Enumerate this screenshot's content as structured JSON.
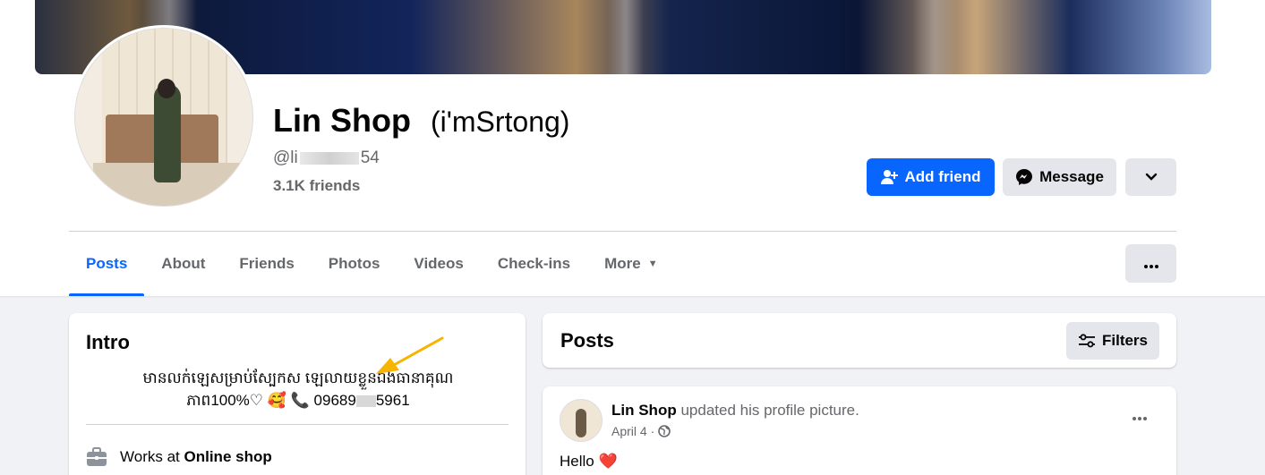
{
  "profile": {
    "name": "Lin Shop",
    "alternate_name": "(i'mSrtong)",
    "handle_start": "@li",
    "handle_end": "54",
    "friends_count": "3.1K friends"
  },
  "actions": {
    "add_friend": "Add friend",
    "message": "Message"
  },
  "tabs": [
    {
      "label": "Posts",
      "active": true
    },
    {
      "label": "About"
    },
    {
      "label": "Friends"
    },
    {
      "label": "Photos"
    },
    {
      "label": "Videos"
    },
    {
      "label": "Check-ins"
    },
    {
      "label": "More"
    }
  ],
  "intro": {
    "title": "Intro",
    "bio_line1": "មានលក់ឡេសម្រាប់ស្បែកស ឡេលាយខ្លួនឯងធានាគុណ",
    "bio_line2_start": "ភាព100%♡ 🥰 📞 09689",
    "bio_line2_end": "5961",
    "works_at_prefix": "Works at",
    "works_at_place": "Online shop"
  },
  "posts_section": {
    "title": "Posts",
    "filters_label": "Filters"
  },
  "post": {
    "author": "Lin Shop",
    "action_text": "updated his profile picture.",
    "date": "April 4",
    "separator": "·",
    "text": "Hello ❤️"
  },
  "colors": {
    "accent": "#0866ff",
    "secondary_button": "#e4e6eb",
    "page_background": "#f0f2f5",
    "muted_text": "#65676b"
  }
}
